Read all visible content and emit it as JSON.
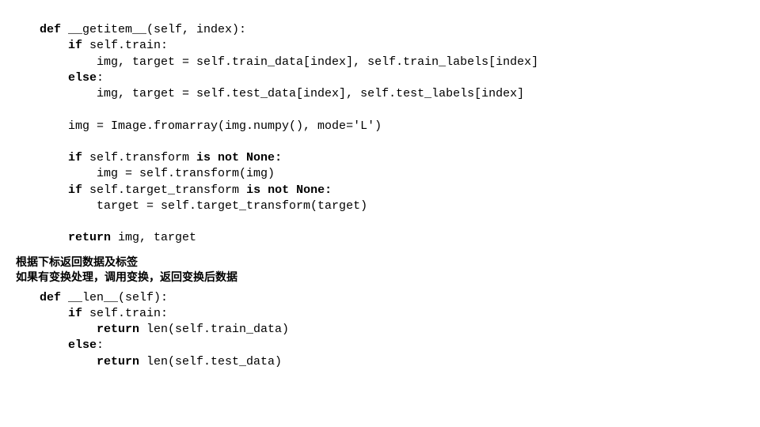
{
  "code1": {
    "l1a": "def",
    "l1b": " __getitem__(self, index):",
    "l2a": "    if",
    "l2b": " self.train:",
    "l3": "        img, target = self.train_data[index], self.train_labels[index]",
    "l4a": "    else",
    "l4b": ":",
    "l5": "        img, target = self.test_data[index], self.test_labels[index]",
    "blank1": " ",
    "l6": "    img = Image.fromarray(img.numpy(), mode='L')",
    "blank2": " ",
    "l7a": "    if",
    "l7b": " self.transform ",
    "l7c": "is not None:",
    "l8": "        img = self.transform(img)",
    "l9a": "    if",
    "l9b": " self.target_transform ",
    "l9c": "is not None:",
    "l10": "        target = self.target_transform(target)",
    "blank3": " ",
    "l11a": "    return",
    "l11b": " img, target"
  },
  "commentary": {
    "line1": "根据下标返回数据及标签",
    "line2": "如果有变换处理，调用变换，返回变换后数据"
  },
  "code2": {
    "l1a": "def",
    "l1b": " __len__(self):",
    "l2a": "    if",
    "l2b": " self.train:",
    "l3a": "        return",
    "l3b": " len(self.train_data)",
    "l4a": "    else",
    "l4b": ":",
    "l5a": "        return",
    "l5b": " len(self.test_data)"
  }
}
